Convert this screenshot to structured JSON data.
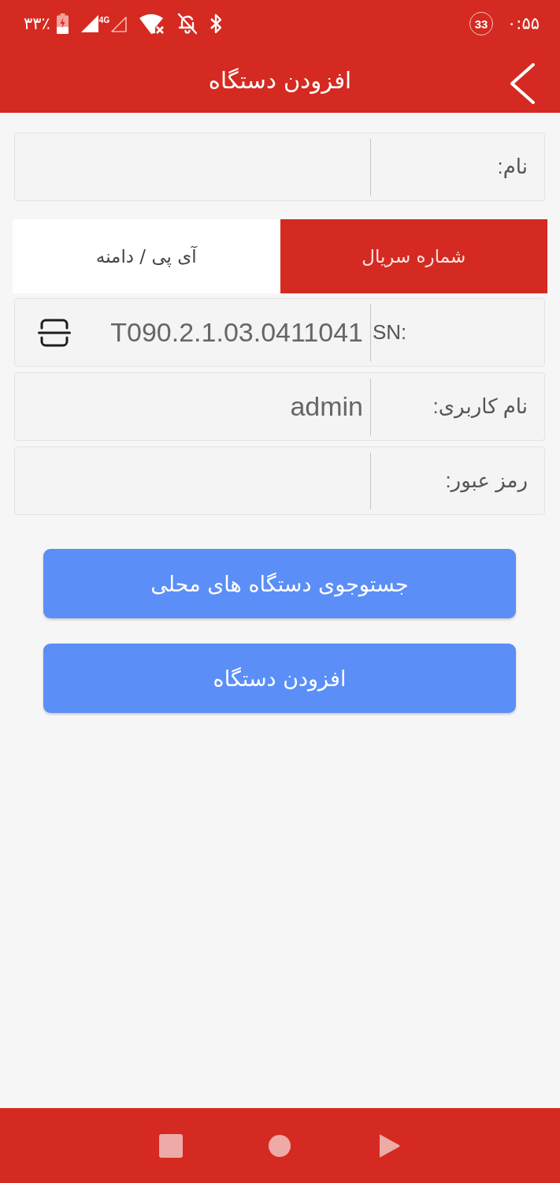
{
  "status_bar": {
    "battery": "۳۳٪",
    "network": "4G",
    "notification_count": "33",
    "time": "۰:۵۵"
  },
  "header": {
    "title": "افزودن دستگاه"
  },
  "name_field": {
    "label": "نام:"
  },
  "tabs": [
    {
      "label": "شماره سریال",
      "selected": true
    },
    {
      "label": "آی پی / دامنه",
      "selected": false
    }
  ],
  "fields": [
    {
      "kind": "scan",
      "label": "SN:",
      "value": "T090.2.1.03.0411041"
    },
    {
      "kind": "text",
      "label": "نام کاربری:",
      "value": "admin"
    },
    {
      "kind": "password",
      "label": "رمز عبور:"
    }
  ],
  "buttons": [
    {
      "label": "جستوجوی دستگاه های محلی"
    },
    {
      "label": "افزودن دستگاه"
    }
  ]
}
